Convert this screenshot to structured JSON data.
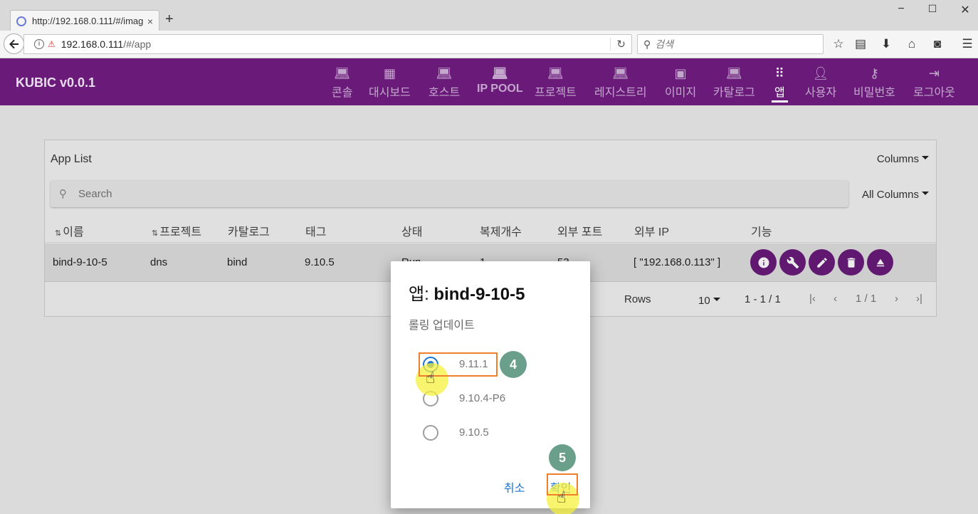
{
  "browser": {
    "tab_title": "http://192.168.0.111/#/imag",
    "tab_close": "×",
    "new_tab": "+",
    "url_host": "192.168.0.111",
    "url_path": "/#/app",
    "search_placeholder": "검색",
    "window_controls": [
      "−",
      "☐",
      "✕"
    ]
  },
  "app": {
    "brand": "KUBIC v0.0.1",
    "nav": [
      {
        "label": "콘솔",
        "icon": "laptop-icon"
      },
      {
        "label": "대시보드",
        "icon": "dashboard-icon"
      },
      {
        "label": "호스트",
        "icon": "laptop-icon"
      },
      {
        "label": "IP POOL",
        "icon": "laptop-icon"
      },
      {
        "label": "프로젝트",
        "icon": "laptop-icon"
      },
      {
        "label": "레지스트리",
        "icon": "laptop-icon"
      },
      {
        "label": "이미지",
        "icon": "image-icon"
      },
      {
        "label": "카탈로그",
        "icon": "laptop-icon"
      },
      {
        "label": "앱",
        "icon": "apps-grid-icon"
      },
      {
        "label": "사용자",
        "icon": "person-icon"
      },
      {
        "label": "비밀번호",
        "icon": "key-icon"
      },
      {
        "label": "로그아웃",
        "icon": "logout-icon"
      }
    ],
    "active_nav": "앱"
  },
  "app_list": {
    "title": "App List",
    "columns_button": "Columns",
    "search_placeholder": "Search",
    "all_columns_button": "All Columns",
    "headers": [
      "이름",
      "프로젝트",
      "카탈로그",
      "태그",
      "상태",
      "복제개수",
      "외부 포트",
      "외부 IP",
      "기능"
    ],
    "rows": [
      {
        "name": "bind-9-10-5",
        "project": "dns",
        "catalog": "bind",
        "tag": "9.10.5",
        "status": "Run",
        "replicas": "1",
        "port": "53",
        "external_ip": "[ \"192.168.0.113\" ]"
      }
    ],
    "actions": [
      "info-icon",
      "wrench-icon",
      "pencil-icon",
      "trash-icon",
      "eject-icon"
    ],
    "footer": {
      "rows_label": "Rows",
      "rows_per_page": "10",
      "range": "1 - 1 / 1",
      "page": "1 / 1"
    }
  },
  "dialog": {
    "title_prefix": "앱: ",
    "title_name": "bind-9-10-5",
    "subtitle": "롤링 업데이트",
    "options": [
      "9.11.1",
      "9.10.4-P6",
      "9.10.5"
    ],
    "selected": "9.11.1",
    "cancel_label": "취소",
    "confirm_label": "확인"
  },
  "annotations": {
    "step_select": "4",
    "step_confirm": "5",
    "highlight_color": "#f07f2d",
    "step_color": "#6a9f8c"
  },
  "colors": {
    "primary": "#6a1b7a",
    "accent": "#1976d2"
  }
}
